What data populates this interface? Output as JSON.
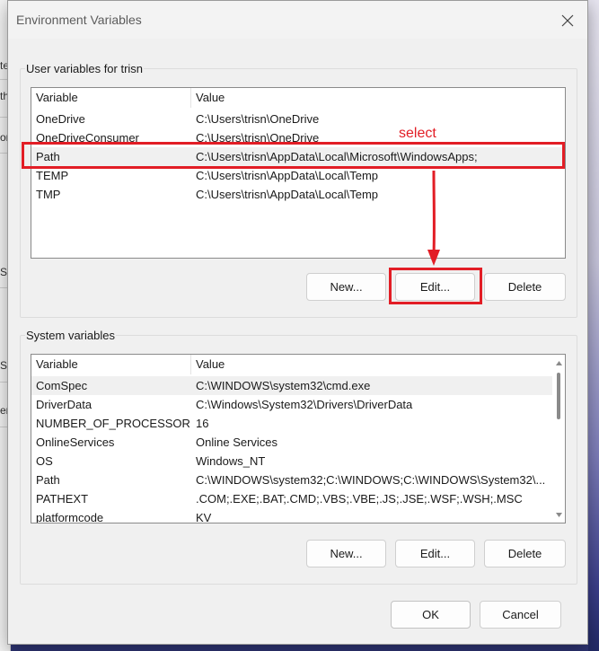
{
  "background_window": {
    "fragments": [
      "te",
      "th",
      "ort",
      "S",
      "S",
      "en"
    ]
  },
  "dialog": {
    "title": "Environment Variables",
    "close_icon": "close-icon"
  },
  "user_section": {
    "label": "User variables for trisn",
    "columns": [
      "Variable",
      "Value"
    ],
    "rows": [
      {
        "variable": "OneDrive",
        "value": "C:\\Users\\trisn\\OneDrive"
      },
      {
        "variable": "OneDriveConsumer",
        "value": "C:\\Users\\trisn\\OneDrive"
      },
      {
        "variable": "Path",
        "value": "C:\\Users\\trisn\\AppData\\Local\\Microsoft\\WindowsApps;"
      },
      {
        "variable": "TEMP",
        "value": "C:\\Users\\trisn\\AppData\\Local\\Temp"
      },
      {
        "variable": "TMP",
        "value": "C:\\Users\\trisn\\AppData\\Local\\Temp"
      }
    ],
    "buttons": {
      "new": "New...",
      "edit": "Edit...",
      "delete": "Delete"
    }
  },
  "system_section": {
    "label": "System variables",
    "columns": [
      "Variable",
      "Value"
    ],
    "rows": [
      {
        "variable": "ComSpec",
        "value": "C:\\WINDOWS\\system32\\cmd.exe"
      },
      {
        "variable": "DriverData",
        "value": "C:\\Windows\\System32\\Drivers\\DriverData"
      },
      {
        "variable": "NUMBER_OF_PROCESSORS",
        "value": "16"
      },
      {
        "variable": "OnlineServices",
        "value": "Online Services"
      },
      {
        "variable": "OS",
        "value": "Windows_NT"
      },
      {
        "variable": "Path",
        "value": "C:\\WINDOWS\\system32;C:\\WINDOWS;C:\\WINDOWS\\System32\\..."
      },
      {
        "variable": "PATHEXT",
        "value": ".COM;.EXE;.BAT;.CMD;.VBS;.VBE;.JS;.JSE;.WSF;.WSH;.MSC"
      },
      {
        "variable": "platformcode",
        "value": "KV"
      }
    ],
    "buttons": {
      "new": "New...",
      "edit": "Edit...",
      "delete": "Delete"
    }
  },
  "footer": {
    "ok": "OK",
    "cancel": "Cancel"
  },
  "annotation": {
    "text": "select",
    "color": "#e21d25"
  }
}
